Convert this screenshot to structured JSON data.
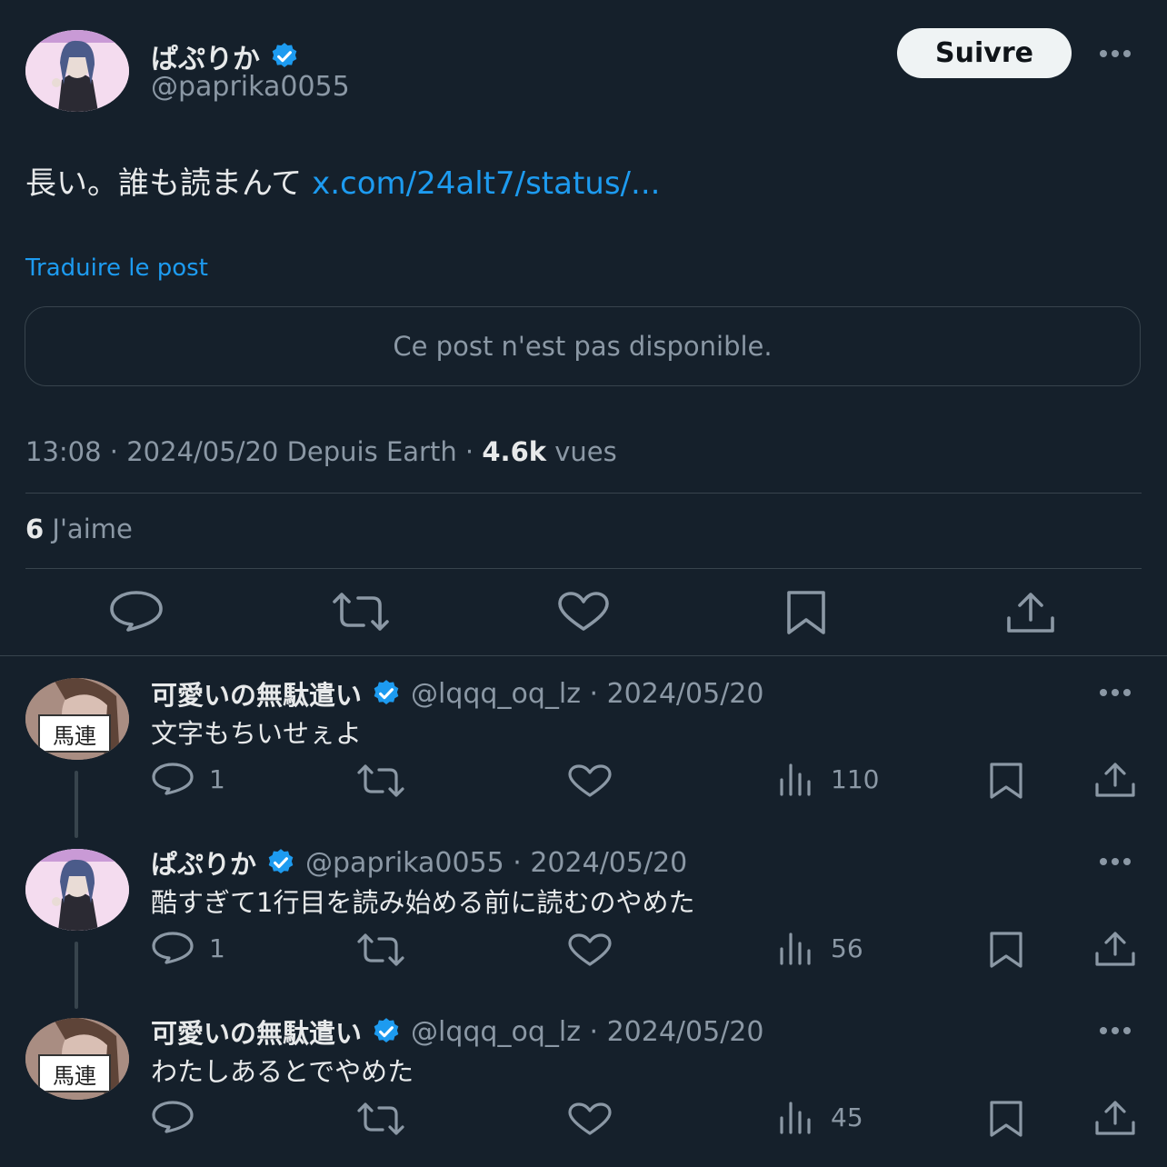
{
  "post": {
    "author_name": "ぱぷりか",
    "author_handle": "@paprika0055",
    "follow_label": "Suivre",
    "text": "長い。誰も読まんて",
    "link_text": "x.com/24alt7/status/...",
    "translate_label": "Traduire le post",
    "unavailable_text": "Ce post n'est pas disponible.",
    "meta_time": "13:08 · 2024/05/20 Depuis Earth · ",
    "views_count": "4.6k",
    "views_label": " vues",
    "likes_count": "6",
    "likes_label": " J'aime"
  },
  "replies": [
    {
      "name": "可愛いの無駄遣い",
      "handle_date": "@lqqq_oq_lz · 2024/05/20",
      "avatar_text": "馬連",
      "text": "文字もちいせぇよ",
      "reply_count": "1",
      "views": "110"
    },
    {
      "name": "ぱぷりか",
      "handle_date": "@paprika0055 · 2024/05/20",
      "text": "酷すぎて1行目を読み始める前に読むのやめた",
      "reply_count": "1",
      "views": "56"
    },
    {
      "name": "可愛いの無駄遣い",
      "handle_date": "@lqqq_oq_lz · 2024/05/20",
      "avatar_text": "馬連",
      "text": "わたしあるとでやめた",
      "reply_count": "",
      "views": "45"
    }
  ],
  "colors": {
    "background": "#15202b",
    "accent": "#1d9bf0",
    "muted": "#8b98a5",
    "divider": "#38444d"
  }
}
